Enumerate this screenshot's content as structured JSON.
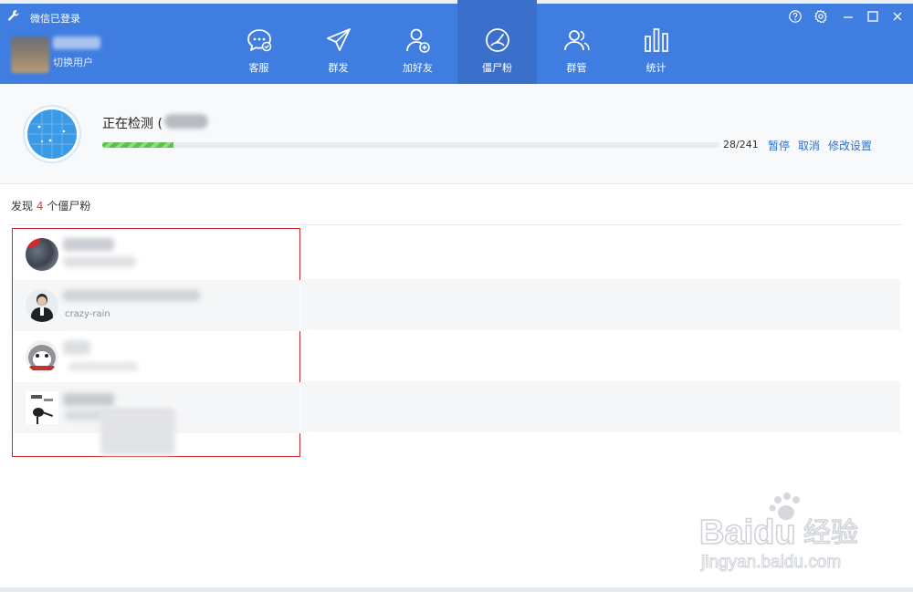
{
  "window": {
    "title": "微信已登录",
    "controls": [
      "help-icon",
      "settings-icon",
      "minimize-icon",
      "maximize-icon",
      "close-icon"
    ]
  },
  "user": {
    "switch_label": "切换用户"
  },
  "nav": {
    "items": [
      {
        "label": "客服",
        "icon": "chat-icon",
        "active": false
      },
      {
        "label": "群发",
        "icon": "send-icon",
        "active": false
      },
      {
        "label": "加好友",
        "icon": "add-friend-icon",
        "active": false
      },
      {
        "label": "僵尸粉",
        "icon": "gauge-icon",
        "active": true
      },
      {
        "label": "群管",
        "icon": "group-icon",
        "active": false
      },
      {
        "label": "统计",
        "icon": "bar-chart-icon",
        "active": false
      }
    ]
  },
  "status": {
    "title": "正在检测 (",
    "progress_text": "28/241",
    "progress_fraction": 0.116,
    "actions": {
      "pause": "暂停",
      "cancel": "取消",
      "settings": "修改设置"
    }
  },
  "results": {
    "prefix": "发现",
    "count": "4",
    "suffix": "个僵尸粉",
    "items": [
      {
        "subtitle": ""
      },
      {
        "subtitle": "crazy-rain"
      },
      {
        "subtitle": ""
      },
      {
        "subtitle": ""
      }
    ]
  },
  "watermark": {
    "brand": "Baidu",
    "cn": "经验",
    "url": "jingyan.baidu.com"
  },
  "colors": {
    "header": "#3f7de0",
    "nav_active": "#3a6fcc",
    "progress": "#5cc04b",
    "link": "#2f6fcf",
    "count": "#e03b3b",
    "highlight_border": "#c9262a"
  }
}
